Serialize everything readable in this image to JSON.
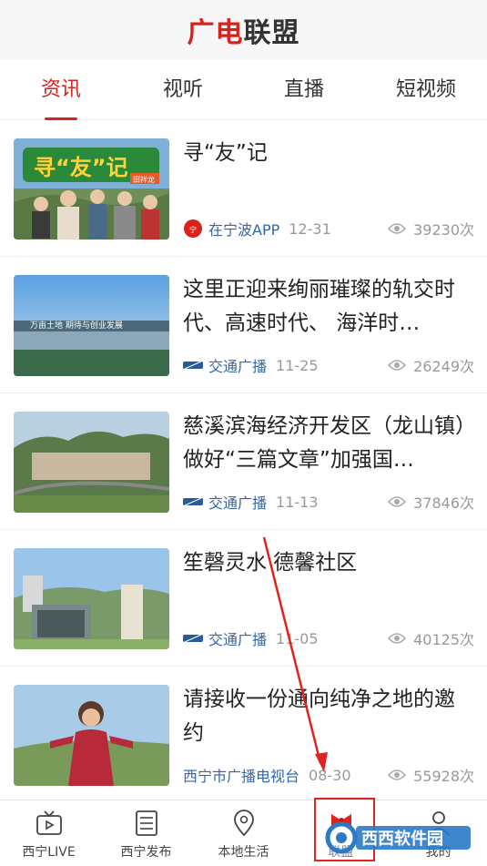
{
  "header": {
    "logo_part1": "广电",
    "logo_part2": "联盟"
  },
  "tabs": [
    {
      "label": "资讯",
      "active": true
    },
    {
      "label": "视听",
      "active": false
    },
    {
      "label": "直播",
      "active": false
    },
    {
      "label": "短视频",
      "active": false
    }
  ],
  "feed": [
    {
      "title": "寻“友”记",
      "source": "在宁波APP",
      "date": "12-31",
      "views": "39230次",
      "thumb_text": "寻“友”记",
      "thumb_sub": "田祥龙"
    },
    {
      "title": "这里正迎来绚丽璀璨的轨交时代、高速时代、 海洋时…",
      "source": "交通广播",
      "date": "11-25",
      "views": "26249次",
      "thumb_text": "万亩土地 期待与创业发展"
    },
    {
      "title": "慈溪滨海经济开发区（龙山镇）做好“三篇文章”加强国…",
      "source": "交通广播",
      "date": "11-13",
      "views": "37846次"
    },
    {
      "title": "笙磬灵水 德馨社区",
      "source": "交通广播",
      "date": "11-05",
      "views": "40125次"
    },
    {
      "title": "请接收一份通向纯净之地的邀约",
      "source": "西宁市广播电视台",
      "date": "08-30",
      "views": "55928次"
    }
  ],
  "bottom_nav": [
    {
      "label": "西宁LIVE",
      "icon": "tv-icon"
    },
    {
      "label": "西宁发布",
      "icon": "list-icon"
    },
    {
      "label": "本地生活",
      "icon": "location-pin-icon"
    },
    {
      "label": "联盟",
      "icon": "bow-icon"
    },
    {
      "label": "我的",
      "icon": "person-icon"
    }
  ],
  "watermark": {
    "text": "西西软件园"
  },
  "colors": {
    "accent": "#d8231c",
    "source_blue": "#3366aa",
    "muted": "#999999"
  }
}
